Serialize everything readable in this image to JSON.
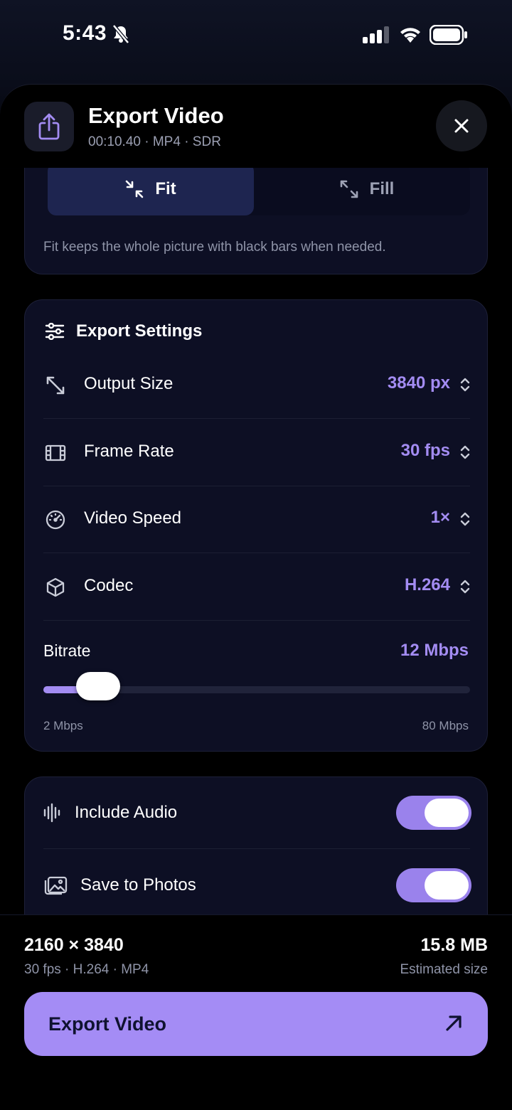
{
  "status_bar": {
    "time": "5:43"
  },
  "header": {
    "title": "Export Video",
    "subtitle": "00:10.40 · MP4 · SDR"
  },
  "scale_mode": {
    "options": [
      {
        "label": "Fit",
        "selected": true
      },
      {
        "label": "Fill",
        "selected": false
      }
    ],
    "note": "Fit keeps the whole picture with black bars when needed."
  },
  "export_settings": {
    "title": "Export Settings",
    "rows": [
      {
        "label": "Output Size",
        "value": "3840 px",
        "icon": "resize-icon"
      },
      {
        "label": "Frame Rate",
        "value": "30 fps",
        "icon": "film-icon"
      },
      {
        "label": "Video Speed",
        "value": "1×",
        "icon": "speedometer-icon"
      },
      {
        "label": "Codec",
        "value": "H.264",
        "icon": "cube-icon"
      }
    ],
    "bitrate": {
      "label": "Bitrate",
      "value": "12 Mbps",
      "min_label": "2 Mbps",
      "max_label": "80 Mbps",
      "level": 0.128
    }
  },
  "toggles": [
    {
      "label": "Include Audio",
      "on": true,
      "icon": "waveform-icon"
    },
    {
      "label": "Save to Photos",
      "on": true,
      "icon": "photos-icon"
    }
  ],
  "summary": {
    "dimensions": "2160 × 3840",
    "details": "30 fps · H.264 · MP4",
    "size": "15.8 MB",
    "size_label": "Estimated size"
  },
  "export_button": {
    "label": "Export Video"
  },
  "colors": {
    "accent": "#a38cf2",
    "background": "#000000",
    "card": "#0d0f24"
  }
}
